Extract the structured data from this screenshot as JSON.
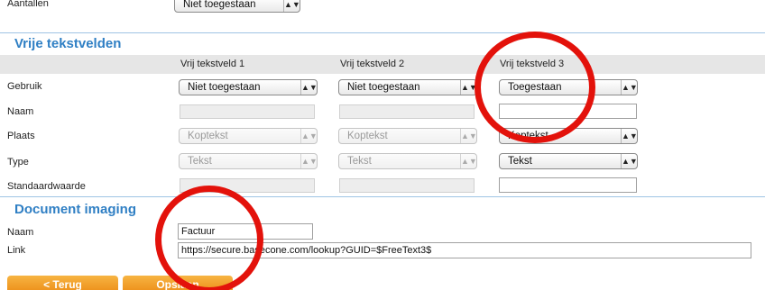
{
  "top": {
    "label": "Aantallen",
    "select_value": "Niet toegestaan"
  },
  "free_text": {
    "title": "Vrije tekstvelden",
    "columns": [
      "Vrij tekstveld 1",
      "Vrij tekstveld 2",
      "Vrij tekstveld 3"
    ],
    "row_labels": {
      "gebruik": "Gebruik",
      "naam": "Naam",
      "plaats": "Plaats",
      "type": "Type",
      "standaard": "Standaardwaarde"
    },
    "gebruik": [
      "Niet toegestaan",
      "Niet toegestaan",
      "Toegestaan"
    ],
    "plaats": [
      "Koptekst",
      "Koptekst",
      "Koptekst"
    ],
    "type": [
      "Tekst",
      "Tekst",
      "Tekst"
    ]
  },
  "document_imaging": {
    "title": "Document imaging",
    "naam_label": "Naam",
    "naam_value": "Factuur",
    "link_label": "Link",
    "link_value": "https://secure.basecone.com/lookup?GUID=$FreeText3$"
  },
  "buttons": {
    "back": "< Terug",
    "save": "Opslaan"
  },
  "colors": {
    "accent": "#2f7fc4",
    "button": "#ec8c16",
    "annotation": "#e3120b"
  }
}
